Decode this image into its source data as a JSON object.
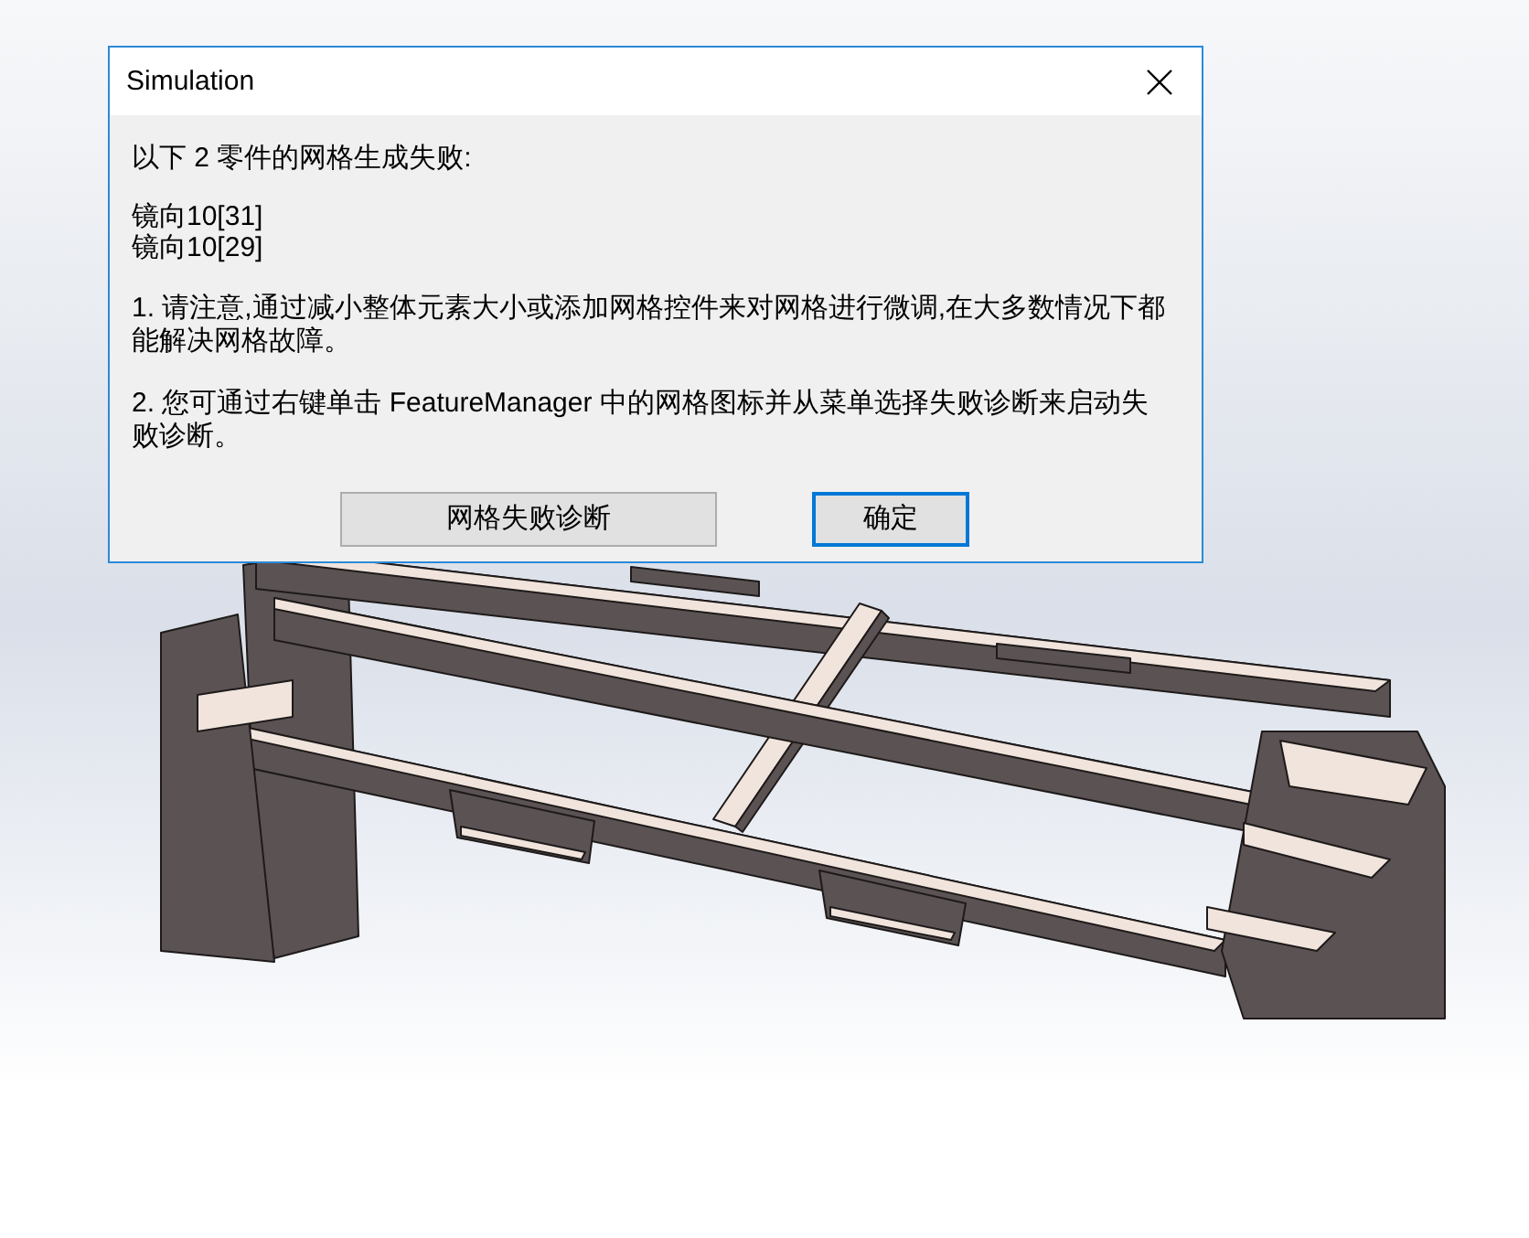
{
  "window": {
    "title": "Simulation"
  },
  "dialog": {
    "heading": "以下 2 零件的网格生成失败:",
    "failed_parts": [
      "镜向10[31]",
      "镜向10[29]"
    ],
    "notes": [
      "1. 请注意,通过减小整体元素大小或添加网格控件来对网格进行微调,在大多数情况下都能解决网格故障。",
      "2. 您可通过右键单击 FeatureManager 中的网格图标并从菜单选择失败诊断来启动失败诊断。"
    ],
    "buttons": [
      {
        "label": "网格失败诊断",
        "focused": false
      },
      {
        "label": "确定",
        "focused": true
      }
    ]
  }
}
